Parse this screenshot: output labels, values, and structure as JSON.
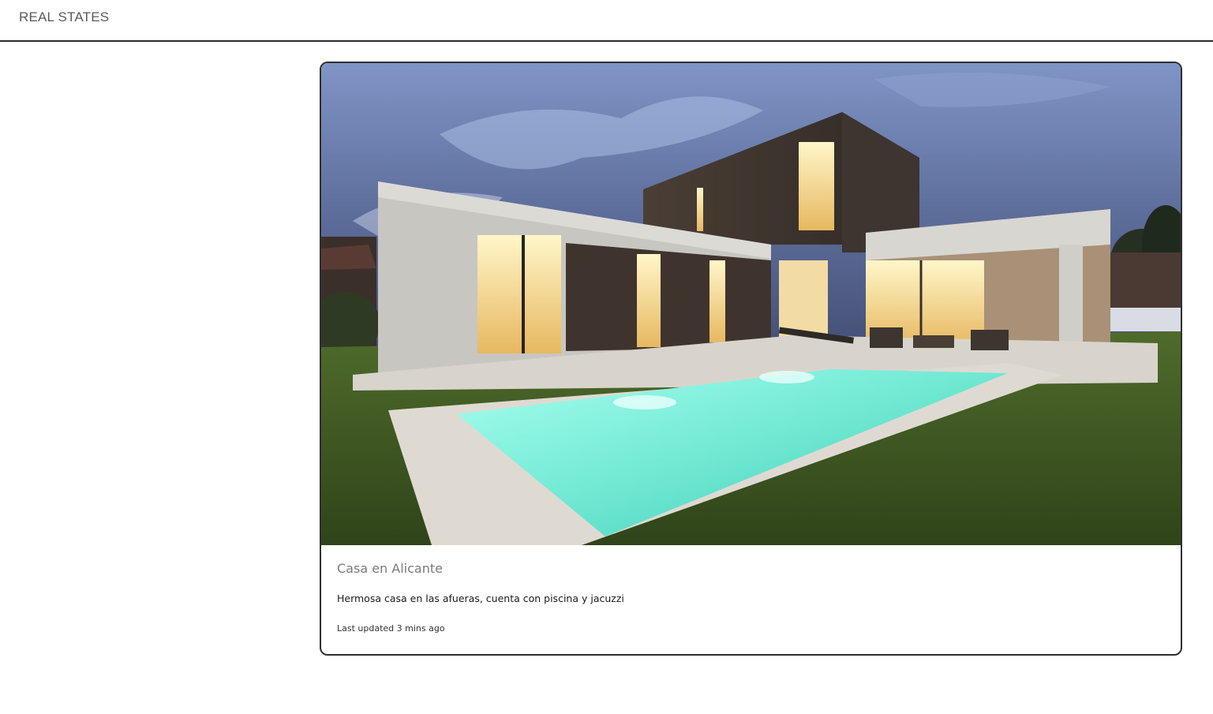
{
  "navbar": {
    "brand": "REAL STATES"
  },
  "card": {
    "image_alt": "Modern house with illuminated windows and swimming pool at dusk",
    "title": "Casa en Alicante",
    "text": "Hermosa casa en las afueras, cuenta con piscina y jacuzzi",
    "updated": "Last updated 3 mins ago"
  },
  "colors": {
    "brand_text": "#5a5a5a",
    "border": "#2f2f2f",
    "pool": "#7ff0dc",
    "sky": "#5c6f9e"
  }
}
